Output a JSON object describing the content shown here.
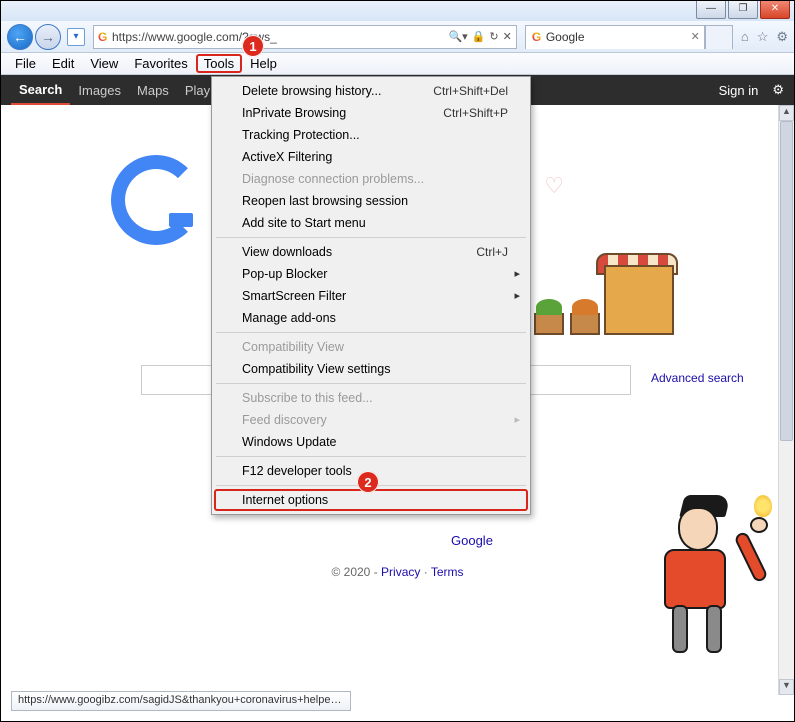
{
  "window": {
    "minimize": "—",
    "maximize": "❐",
    "close": "✕"
  },
  "nav": {
    "url": "https://www.google.com/?gws_",
    "search_hint_icon": "🔍",
    "lock": "🔒",
    "refresh": "↻",
    "stop": "✕"
  },
  "tab": {
    "title": "Google"
  },
  "chrome_icons": {
    "home": "⌂",
    "fav": "☆",
    "gear": "⚙"
  },
  "menubar": {
    "items": [
      "File",
      "Edit",
      "View",
      "Favorites",
      "Tools",
      "Help"
    ],
    "active_index": 4
  },
  "gbar": {
    "items": [
      "Search",
      "Images",
      "Maps",
      "Play"
    ],
    "signin": "Sign in"
  },
  "dropdown": {
    "groups": [
      [
        {
          "label": "Delete browsing history...",
          "shortcut": "Ctrl+Shift+Del"
        },
        {
          "label": "InPrivate Browsing",
          "shortcut": "Ctrl+Shift+P"
        },
        {
          "label": "Tracking Protection..."
        },
        {
          "label": "ActiveX Filtering"
        },
        {
          "label": "Diagnose connection problems...",
          "disabled": true
        },
        {
          "label": "Reopen last browsing session"
        },
        {
          "label": "Add site to Start menu"
        }
      ],
      [
        {
          "label": "View downloads",
          "shortcut": "Ctrl+J"
        },
        {
          "label": "Pop-up Blocker",
          "submenu": true
        },
        {
          "label": "SmartScreen Filter",
          "submenu": true
        },
        {
          "label": "Manage add-ons"
        }
      ],
      [
        {
          "label": "Compatibility View",
          "disabled": true
        },
        {
          "label": "Compatibility View settings"
        }
      ],
      [
        {
          "label": "Subscribe to this feed...",
          "disabled": true
        },
        {
          "label": "Feed discovery",
          "submenu": true,
          "disabled": true
        },
        {
          "label": "Windows Update"
        }
      ],
      [
        {
          "label": "F12 developer tools"
        }
      ],
      [
        {
          "label": "Internet options",
          "highlight": true
        }
      ]
    ]
  },
  "callouts": {
    "one": "1",
    "two": "2"
  },
  "page": {
    "advanced": "Advanced search",
    "google_link": "Google",
    "footer": {
      "copyright": "© 2020 - ",
      "privacy": "Privacy",
      "sep": " · ",
      "terms": "Terms"
    }
  },
  "status": "https://www.googibz.com/sagidJS&thankyou+coronavirus+helpers&oi=d..."
}
